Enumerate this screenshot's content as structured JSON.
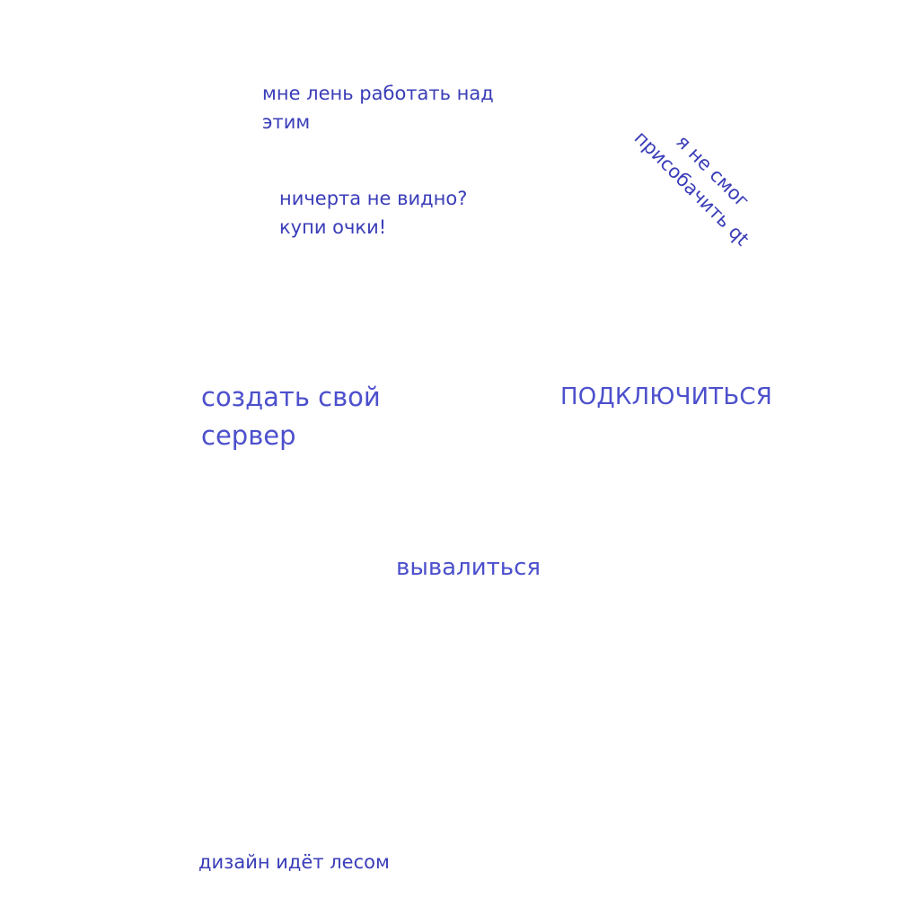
{
  "notes": {
    "lazy": [
      "мне лень работать над",
      "этим"
    ],
    "glasses": [
      "ничерта не видно?",
      "купи очки!"
    ],
    "qt": [
      "я не смог",
      "присобачить qt"
    ]
  },
  "menu": {
    "create_server": [
      "создать свой",
      "сервер"
    ],
    "connect": "ПОДКЛЮЧИТЬСЯ",
    "quit": "вывалиться"
  },
  "footer": {
    "text": "дизайн идёт лесом"
  },
  "colors": {
    "text": "#3a3db8",
    "button_text": "#4c50cc",
    "background": "#ffffff"
  }
}
